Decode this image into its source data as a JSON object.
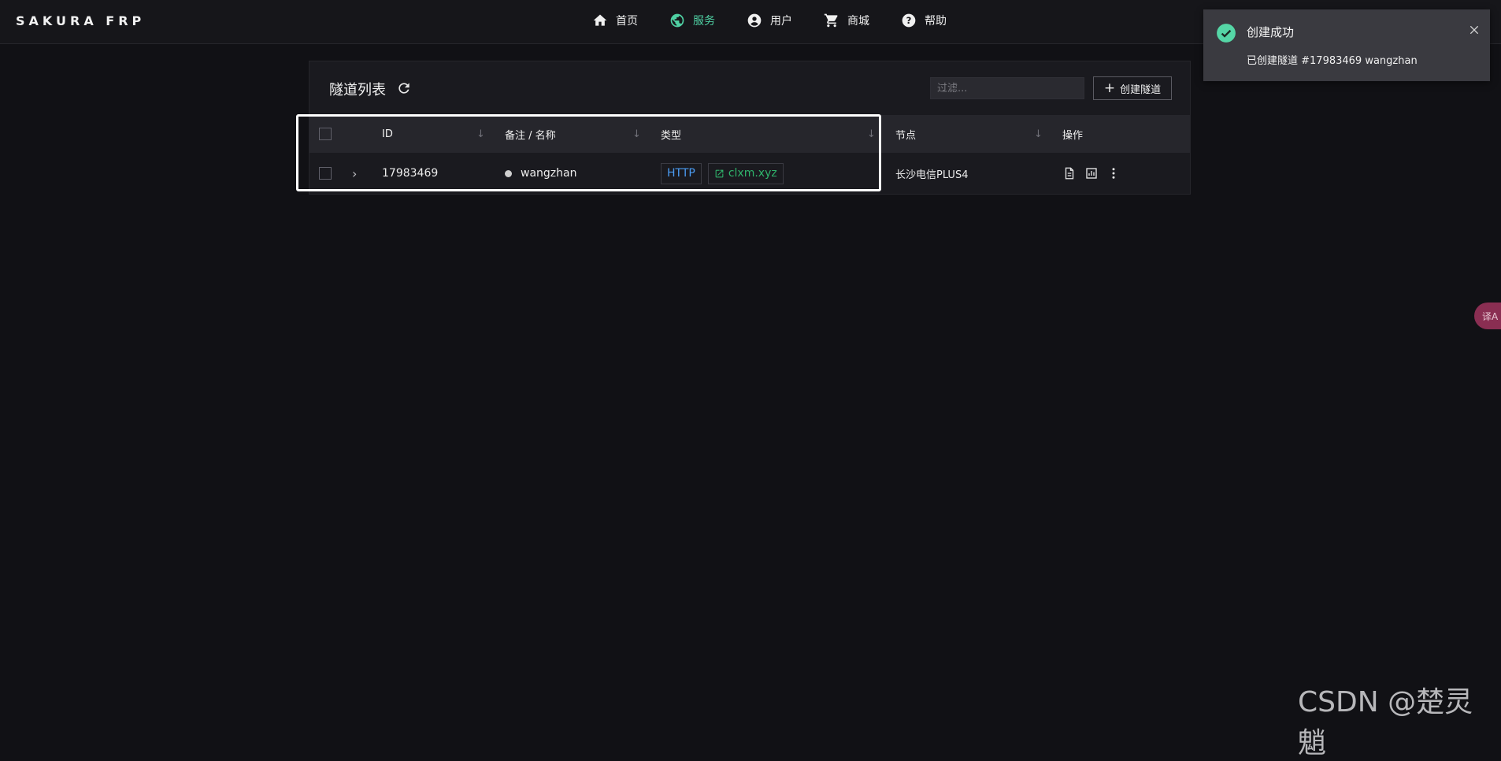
{
  "brand": "SAKURA FRP",
  "nav": [
    {
      "label": "首页",
      "icon": "home-icon"
    },
    {
      "label": "服务",
      "icon": "globe-icon",
      "active": true
    },
    {
      "label": "用户",
      "icon": "user-circle-icon"
    },
    {
      "label": "商城",
      "icon": "cart-icon"
    },
    {
      "label": "帮助",
      "icon": "help-icon"
    }
  ],
  "card": {
    "title": "隧道列表",
    "filter_placeholder": "过滤...",
    "create_label": "创建隧道"
  },
  "table": {
    "headers": {
      "id": "ID",
      "name": "备注 / 名称",
      "type": "类型",
      "node": "节点",
      "actions": "操作"
    },
    "rows": [
      {
        "id": "17983469",
        "name": "wangzhan",
        "type": "HTTP",
        "domain": "clxm.xyz",
        "node": "长沙电信PLUS4"
      }
    ]
  },
  "toast": {
    "title": "创建成功",
    "message": "已创建隧道 #17983469 wangzhan"
  },
  "side_tab": "译A",
  "watermark": "CSDN @楚灵魈",
  "colors": {
    "accent": "#4fd0a3",
    "http": "#4b9cf2",
    "link": "#2fb36b",
    "background": "#111115"
  }
}
